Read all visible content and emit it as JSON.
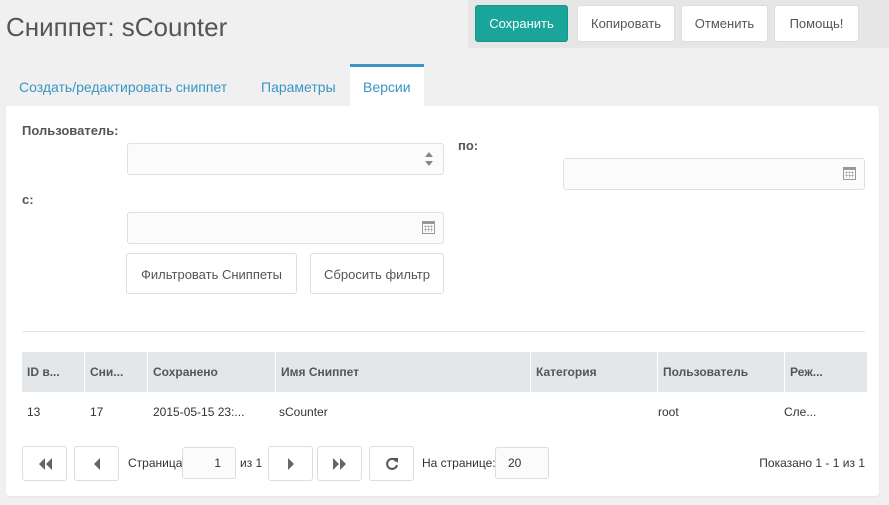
{
  "page": {
    "title": "Сниппет: sCounter"
  },
  "actions": {
    "save": "Сохранить",
    "copy": "Копировать",
    "cancel": "Отменить",
    "help": "Помощь!"
  },
  "tabs": [
    {
      "label": "Создать/редактировать сниппет",
      "active": false
    },
    {
      "label": "Параметры",
      "active": false
    },
    {
      "label": "Версии",
      "active": true
    }
  ],
  "filters": {
    "user_label": "Пользователь:",
    "user_value": "",
    "from_label": "с:",
    "from_value": "",
    "to_label": "по:",
    "to_value": "",
    "filter_button": "Фильтровать Сниппеты",
    "reset_button": "Сбросить фильтр"
  },
  "grid": {
    "columns": [
      "ID в...",
      "Сни...",
      "Сохранено",
      "Имя Сниппет",
      "Категория",
      "Пользователь",
      "Реж..."
    ],
    "rows": [
      [
        "13",
        "17",
        "2015-05-15 23:...",
        "sCounter",
        "",
        "root",
        "Сле..."
      ]
    ]
  },
  "pager": {
    "page_label": "Страница",
    "page_value": "1",
    "of_label": "из 1",
    "per_page_label": "На странице:",
    "per_page_value": "20",
    "shown": "Показано 1 - 1 из 1"
  },
  "colors": {
    "accent": "#1aa59a",
    "tab": "#3a95c4"
  }
}
